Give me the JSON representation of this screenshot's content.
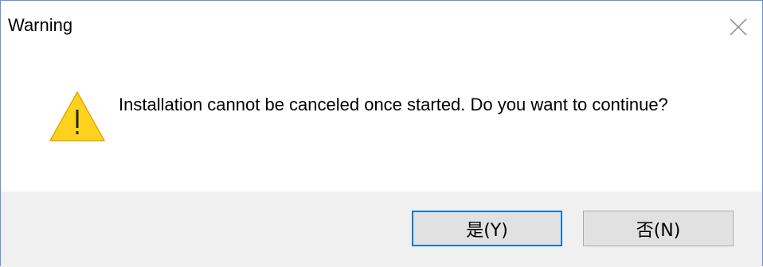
{
  "window": {
    "title": "Warning",
    "close_icon": "close-icon"
  },
  "message": {
    "icon": "warning-triangle-icon",
    "text": "Installation cannot be canceled once started. Do you want to continue?"
  },
  "buttons": {
    "yes_label": "是(Y)",
    "no_label": "否(N)"
  },
  "colors": {
    "warning_icon_fill": "#FFD21F",
    "default_button_border": "#0078D7",
    "footer_background": "#F0F0F0",
    "window_border": "#6A8FD6"
  }
}
